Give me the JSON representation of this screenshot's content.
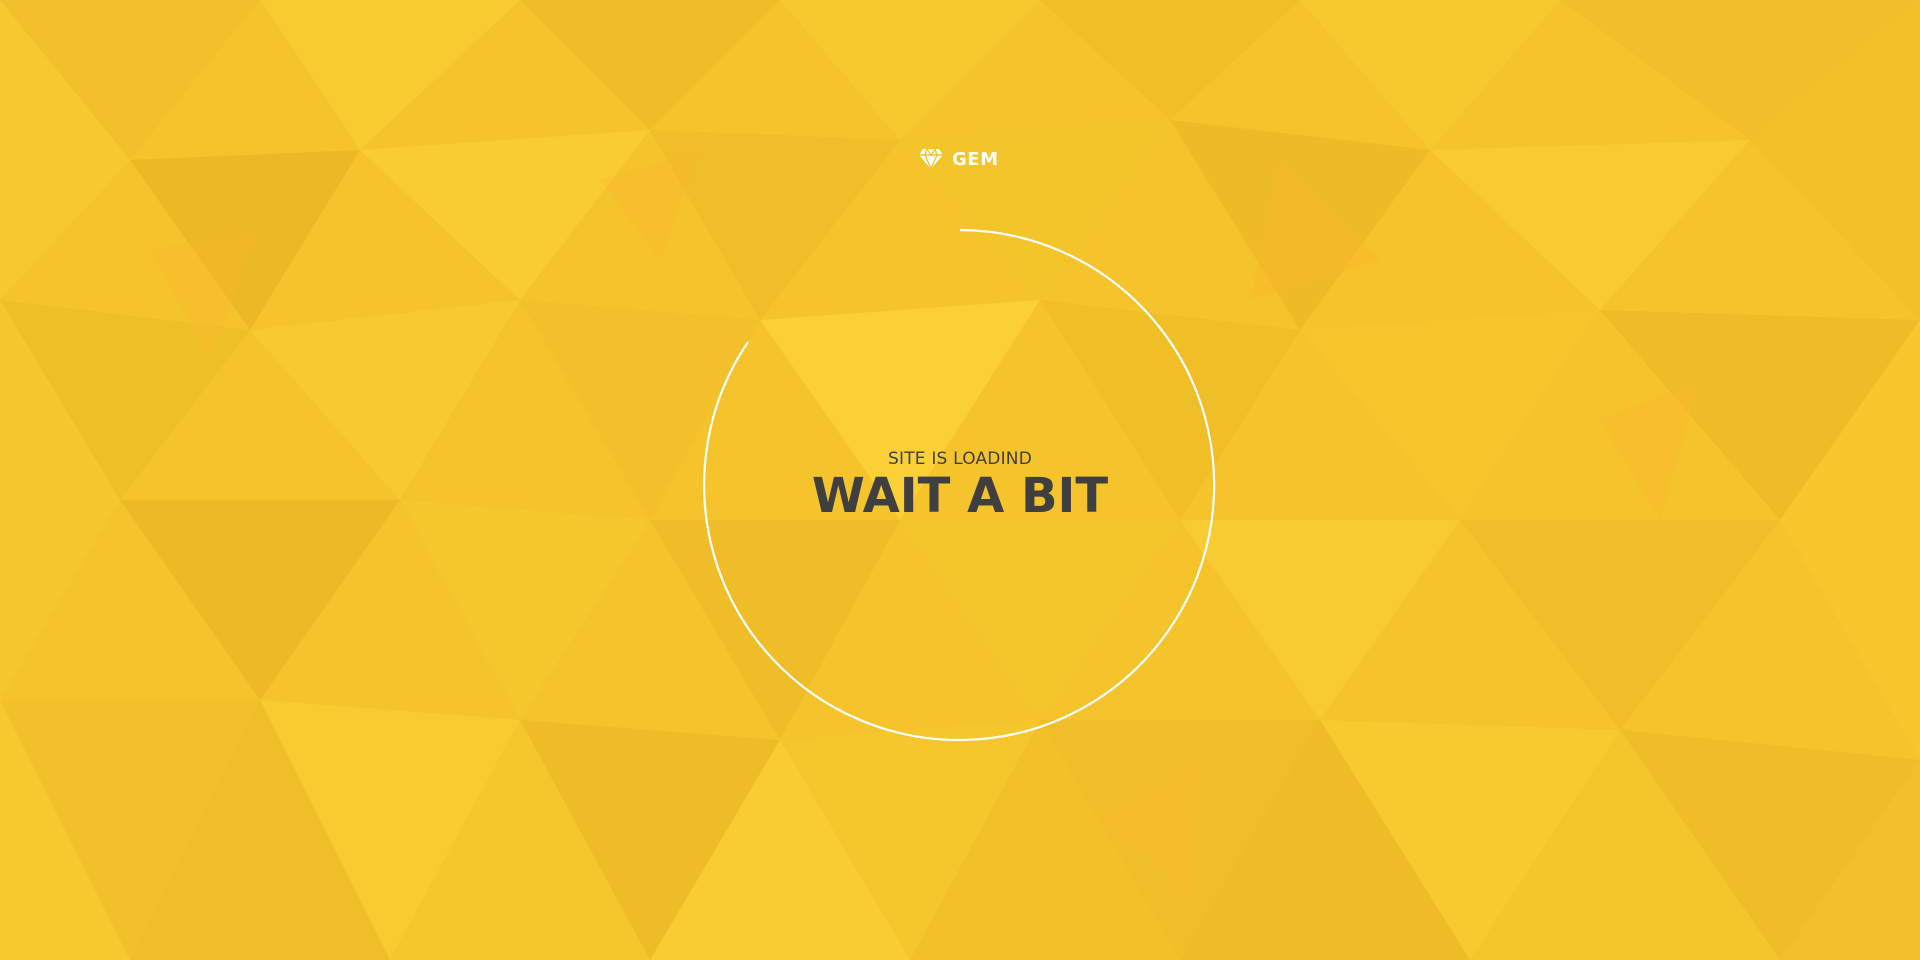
{
  "brand": {
    "name": "GEM",
    "icon": "diamond-icon"
  },
  "loader": {
    "subtitle": "SITE IS LOADIND",
    "title": "WAIT A BIT",
    "icon": "spinner-ring-icon"
  },
  "colors": {
    "background": "#f5c42c",
    "text": "#3f3f3f",
    "logo": "#ffffff",
    "ring": "#ffffff"
  }
}
